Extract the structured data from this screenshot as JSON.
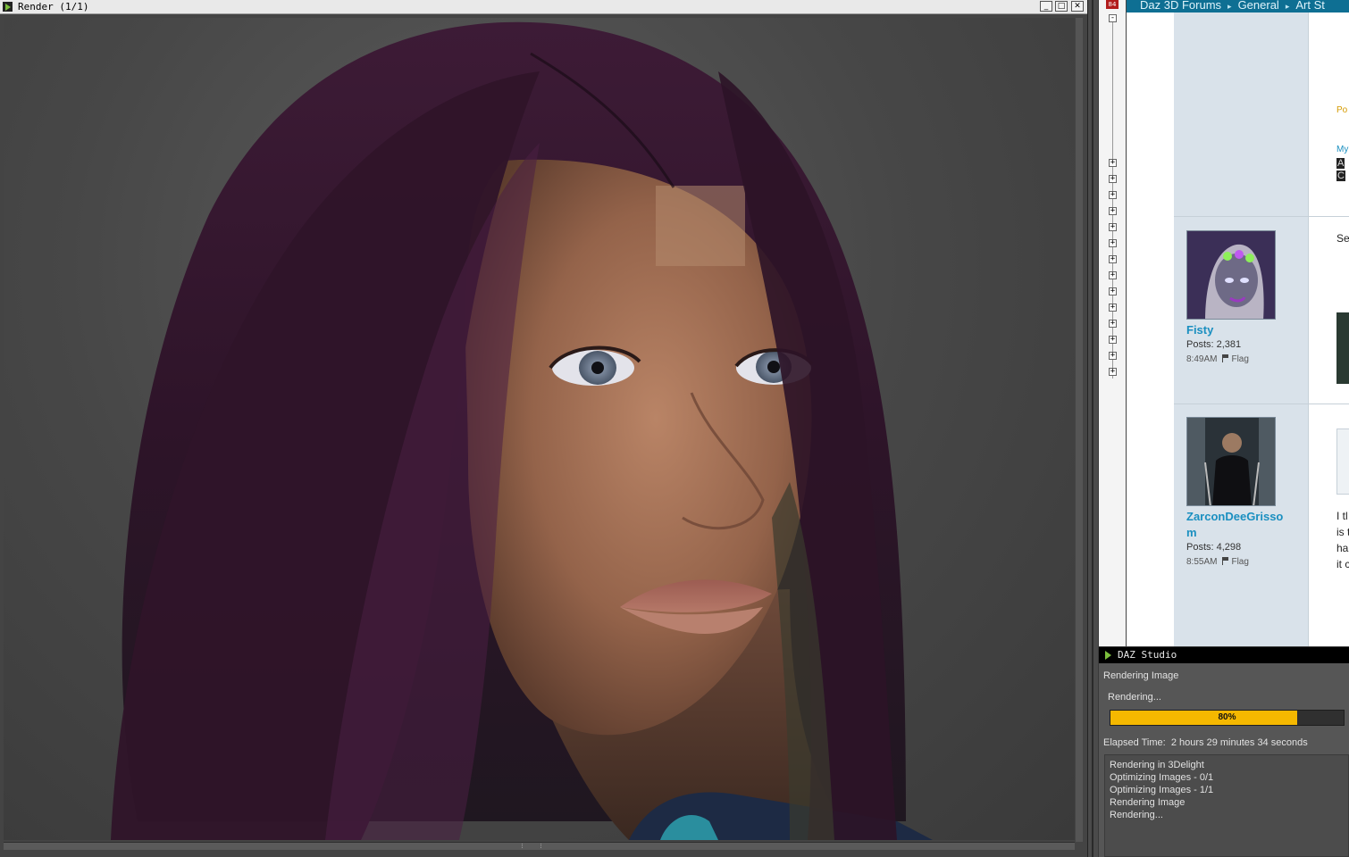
{
  "render_window": {
    "title": "Render (1/1)",
    "buttons": {
      "minimize": "_",
      "maximize": "□",
      "close": "✕"
    }
  },
  "browser": {
    "tab_icon": "84",
    "breadcrumbs": [
      "Daz 3D Forums",
      "General",
      "Art St"
    ],
    "posts": [
      {
        "username": "Fisty",
        "posts": "Posts: 2,381",
        "time": "8:49AM",
        "flag": "Flag"
      },
      {
        "username": "ZarconDeeGrisso",
        "username_wrap": "m",
        "posts": "Posts: 4,298",
        "time": "8:55AM",
        "flag": "Flag"
      }
    ],
    "fragments": [
      "Po",
      "My",
      "A",
      "C",
      "Se",
      "I tl",
      "is t",
      "ha",
      "it c"
    ]
  },
  "progress_dialog": {
    "title": "DAZ Studio",
    "heading": "Rendering Image",
    "status": "Rendering...",
    "progress_percent": 80,
    "progress_label": "80%",
    "elapsed_label": "Elapsed Time:",
    "elapsed_value": "2 hours 29 minutes 34 seconds",
    "log": [
      "Rendering in 3Delight",
      "Optimizing Images - 0/1",
      "Optimizing Images - 1/1",
      "Rendering Image",
      "Rendering..."
    ]
  },
  "colors": {
    "progress_fill": "#f5b800",
    "link_blue": "#1a8fc0",
    "header_bar": "#0e6f93",
    "hair": "#3a1a33",
    "skin": "#b07a5c"
  }
}
